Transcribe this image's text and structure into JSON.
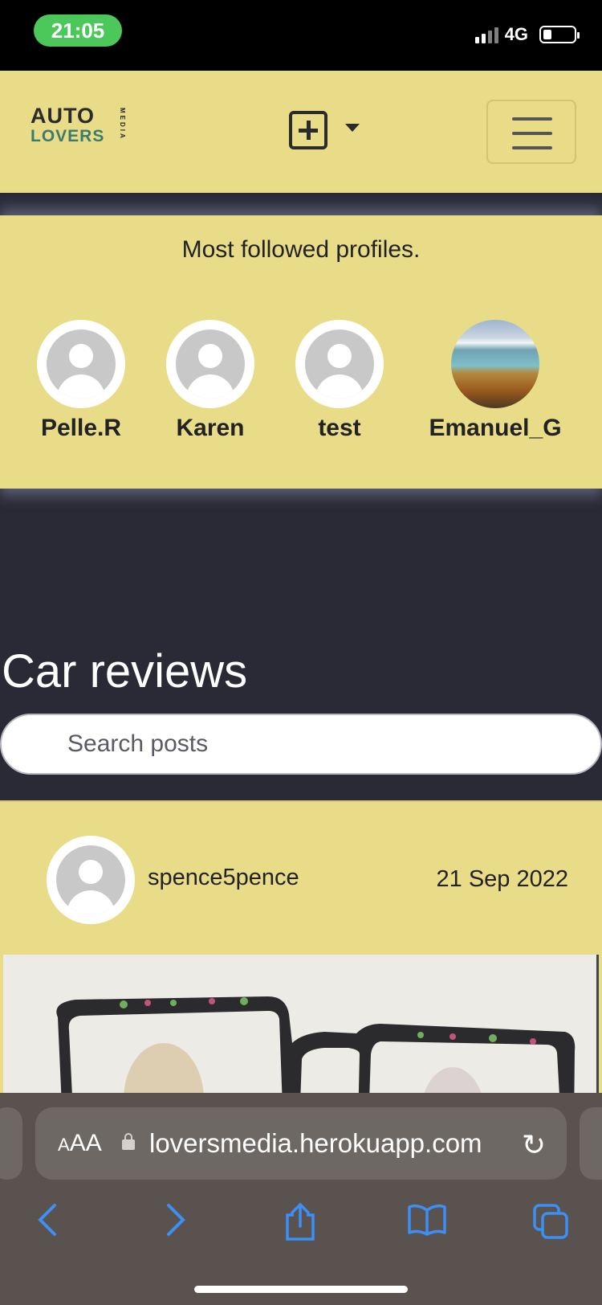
{
  "status_bar": {
    "time": "21:05",
    "network": "4G"
  },
  "navbar": {
    "logo_line1": "AUTO",
    "logo_line2": "LOVERS",
    "logo_side": "MEDIA"
  },
  "followed": {
    "title": "Most followed profiles.",
    "profiles": [
      {
        "name": "Pelle.R",
        "avatar": "default"
      },
      {
        "name": "Karen",
        "avatar": "default"
      },
      {
        "name": "test",
        "avatar": "default"
      },
      {
        "name": "Emanuel_G",
        "avatar": "landscape-photo"
      }
    ]
  },
  "main": {
    "heading": "Car reviews",
    "search_placeholder": "Search posts"
  },
  "post": {
    "author": "spence5pence",
    "date": "21 Sep 2022"
  },
  "safari": {
    "aa_label": "AA",
    "url": "loversmedia.herokuapp.com"
  },
  "colors": {
    "card": "#e8dc88",
    "page_bg": "#2a2a36",
    "accent_green": "#3e7a6c",
    "safari_blue": "#3d8ef5"
  },
  "icons": [
    "add-post-icon",
    "caret-down-icon",
    "hamburger-icon",
    "lock-icon",
    "reload-icon",
    "back-icon",
    "forward-icon",
    "share-icon",
    "bookmarks-icon",
    "tabs-icon"
  ]
}
